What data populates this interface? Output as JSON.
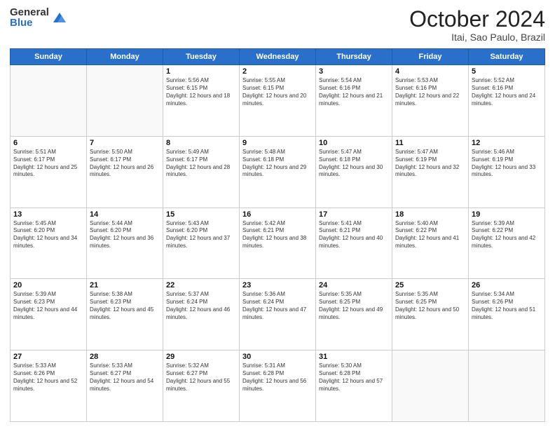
{
  "header": {
    "logo_general": "General",
    "logo_blue": "Blue",
    "title": "October 2024",
    "subtitle": "Itai, Sao Paulo, Brazil"
  },
  "days_of_week": [
    "Sunday",
    "Monday",
    "Tuesday",
    "Wednesday",
    "Thursday",
    "Friday",
    "Saturday"
  ],
  "weeks": [
    [
      {
        "day": "",
        "info": ""
      },
      {
        "day": "",
        "info": ""
      },
      {
        "day": "1",
        "info": "Sunrise: 5:56 AM\nSunset: 6:15 PM\nDaylight: 12 hours and 18 minutes."
      },
      {
        "day": "2",
        "info": "Sunrise: 5:55 AM\nSunset: 6:15 PM\nDaylight: 12 hours and 20 minutes."
      },
      {
        "day": "3",
        "info": "Sunrise: 5:54 AM\nSunset: 6:16 PM\nDaylight: 12 hours and 21 minutes."
      },
      {
        "day": "4",
        "info": "Sunrise: 5:53 AM\nSunset: 6:16 PM\nDaylight: 12 hours and 22 minutes."
      },
      {
        "day": "5",
        "info": "Sunrise: 5:52 AM\nSunset: 6:16 PM\nDaylight: 12 hours and 24 minutes."
      }
    ],
    [
      {
        "day": "6",
        "info": "Sunrise: 5:51 AM\nSunset: 6:17 PM\nDaylight: 12 hours and 25 minutes."
      },
      {
        "day": "7",
        "info": "Sunrise: 5:50 AM\nSunset: 6:17 PM\nDaylight: 12 hours and 26 minutes."
      },
      {
        "day": "8",
        "info": "Sunrise: 5:49 AM\nSunset: 6:17 PM\nDaylight: 12 hours and 28 minutes."
      },
      {
        "day": "9",
        "info": "Sunrise: 5:48 AM\nSunset: 6:18 PM\nDaylight: 12 hours and 29 minutes."
      },
      {
        "day": "10",
        "info": "Sunrise: 5:47 AM\nSunset: 6:18 PM\nDaylight: 12 hours and 30 minutes."
      },
      {
        "day": "11",
        "info": "Sunrise: 5:47 AM\nSunset: 6:19 PM\nDaylight: 12 hours and 32 minutes."
      },
      {
        "day": "12",
        "info": "Sunrise: 5:46 AM\nSunset: 6:19 PM\nDaylight: 12 hours and 33 minutes."
      }
    ],
    [
      {
        "day": "13",
        "info": "Sunrise: 5:45 AM\nSunset: 6:20 PM\nDaylight: 12 hours and 34 minutes."
      },
      {
        "day": "14",
        "info": "Sunrise: 5:44 AM\nSunset: 6:20 PM\nDaylight: 12 hours and 36 minutes."
      },
      {
        "day": "15",
        "info": "Sunrise: 5:43 AM\nSunset: 6:20 PM\nDaylight: 12 hours and 37 minutes."
      },
      {
        "day": "16",
        "info": "Sunrise: 5:42 AM\nSunset: 6:21 PM\nDaylight: 12 hours and 38 minutes."
      },
      {
        "day": "17",
        "info": "Sunrise: 5:41 AM\nSunset: 6:21 PM\nDaylight: 12 hours and 40 minutes."
      },
      {
        "day": "18",
        "info": "Sunrise: 5:40 AM\nSunset: 6:22 PM\nDaylight: 12 hours and 41 minutes."
      },
      {
        "day": "19",
        "info": "Sunrise: 5:39 AM\nSunset: 6:22 PM\nDaylight: 12 hours and 42 minutes."
      }
    ],
    [
      {
        "day": "20",
        "info": "Sunrise: 5:39 AM\nSunset: 6:23 PM\nDaylight: 12 hours and 44 minutes."
      },
      {
        "day": "21",
        "info": "Sunrise: 5:38 AM\nSunset: 6:23 PM\nDaylight: 12 hours and 45 minutes."
      },
      {
        "day": "22",
        "info": "Sunrise: 5:37 AM\nSunset: 6:24 PM\nDaylight: 12 hours and 46 minutes."
      },
      {
        "day": "23",
        "info": "Sunrise: 5:36 AM\nSunset: 6:24 PM\nDaylight: 12 hours and 47 minutes."
      },
      {
        "day": "24",
        "info": "Sunrise: 5:35 AM\nSunset: 6:25 PM\nDaylight: 12 hours and 49 minutes."
      },
      {
        "day": "25",
        "info": "Sunrise: 5:35 AM\nSunset: 6:25 PM\nDaylight: 12 hours and 50 minutes."
      },
      {
        "day": "26",
        "info": "Sunrise: 5:34 AM\nSunset: 6:26 PM\nDaylight: 12 hours and 51 minutes."
      }
    ],
    [
      {
        "day": "27",
        "info": "Sunrise: 5:33 AM\nSunset: 6:26 PM\nDaylight: 12 hours and 52 minutes."
      },
      {
        "day": "28",
        "info": "Sunrise: 5:33 AM\nSunset: 6:27 PM\nDaylight: 12 hours and 54 minutes."
      },
      {
        "day": "29",
        "info": "Sunrise: 5:32 AM\nSunset: 6:27 PM\nDaylight: 12 hours and 55 minutes."
      },
      {
        "day": "30",
        "info": "Sunrise: 5:31 AM\nSunset: 6:28 PM\nDaylight: 12 hours and 56 minutes."
      },
      {
        "day": "31",
        "info": "Sunrise: 5:30 AM\nSunset: 6:28 PM\nDaylight: 12 hours and 57 minutes."
      },
      {
        "day": "",
        "info": ""
      },
      {
        "day": "",
        "info": ""
      }
    ]
  ]
}
